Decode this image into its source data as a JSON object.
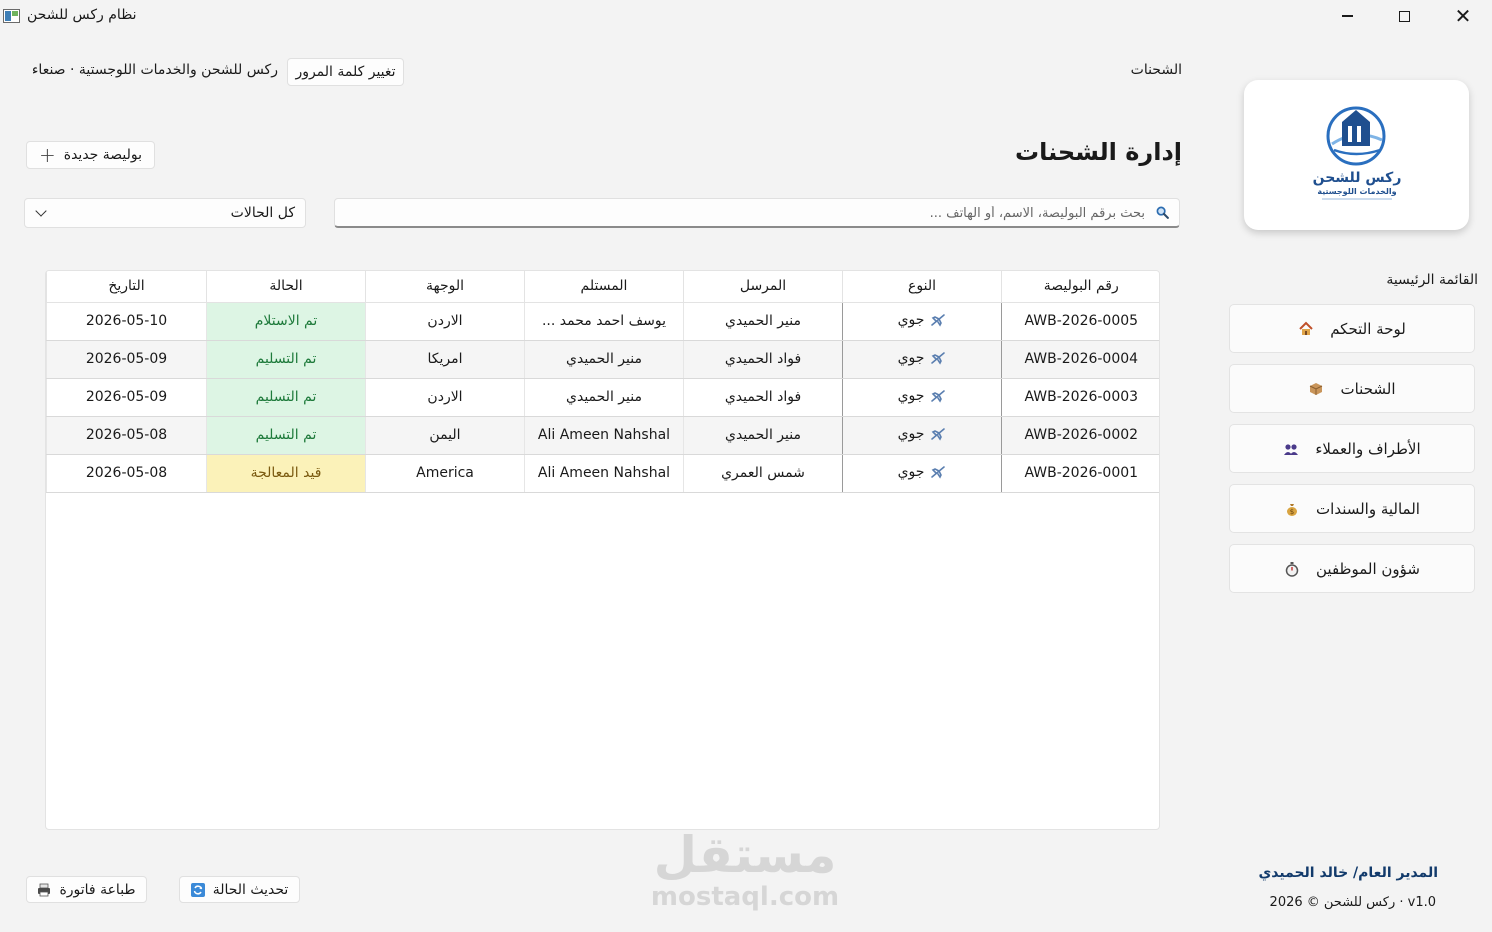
{
  "window": {
    "title": "نظام ركس للشحن"
  },
  "header": {
    "breadcrumb": "الشحنات",
    "company": "ركس للشحن والخدمات اللوجستية · صنعاء",
    "change_password": "تغيير كلمة المرور"
  },
  "page": {
    "title": "إدارة الشحنات",
    "new_button": "بوليصة جديدة",
    "status_filter": "كل الحالات",
    "search_placeholder": "بحث برقم البوليصة، الاسم، أو الهاتف ..."
  },
  "table": {
    "columns": [
      "رقم البوليصة",
      "النوع",
      "المرسل",
      "المستلم",
      "الوجهة",
      "الحالة",
      "التاريخ"
    ],
    "rows": [
      {
        "awb": "AWB-2026-0005",
        "type": "جوي",
        "sender": "منير الحميدي",
        "receiver": "يوسف احمد محمد ...",
        "destination": "الاردن",
        "status": "تم الاستلام",
        "date": "2026-05-10"
      },
      {
        "awb": "AWB-2026-0004",
        "type": "جوي",
        "sender": "فواد  الحميدي",
        "receiver": "منير الحميدي",
        "destination": "امريكا",
        "status": "تم التسليم",
        "date": "2026-05-09"
      },
      {
        "awb": "AWB-2026-0003",
        "type": "جوي",
        "sender": "فواد  الحميدي",
        "receiver": "منير الحميدي",
        "destination": "الاردن",
        "status": "تم التسليم",
        "date": "2026-05-09"
      },
      {
        "awb": "AWB-2026-0002",
        "type": "جوي",
        "sender": "منير الحميدي",
        "receiver": "Ali Ameen Nahshal",
        "destination": "اليمن",
        "status": "تم التسليم",
        "date": "2026-05-08"
      },
      {
        "awb": "AWB-2026-0001",
        "type": "جوي",
        "sender": "شمس العمري",
        "receiver": "Ali Ameen Nahshal",
        "destination": "America",
        "status": "قيد المعالجة",
        "date": "2026-05-08"
      }
    ]
  },
  "sidebar": {
    "heading": "القائمة الرئيسية",
    "items": [
      {
        "label": "لوحة التحكم",
        "icon": "house-icon"
      },
      {
        "label": "الشحنات",
        "icon": "package-icon"
      },
      {
        "label": "الأطراف والعملاء",
        "icon": "users-icon"
      },
      {
        "label": "المالية والسندات",
        "icon": "money-bag-icon"
      },
      {
        "label": "شؤون الموظفين",
        "icon": "stopwatch-icon"
      }
    ],
    "logo": {
      "name": "ركس للشحن",
      "sub": "والخدمات اللوجستية"
    }
  },
  "footer": {
    "manager": "المدير العام/ خالد الحميدي",
    "copyright": "ركس للشحن © 2026 · v1.0",
    "refresh_button": "تحديث الحالة",
    "print_button": "طباعة فاتورة"
  },
  "watermark": {
    "ar": "مستقل",
    "en": "mostaql.com"
  },
  "colors": {
    "status_done_bg": "#ddf5e4",
    "status_pending_bg": "#fbf2b9",
    "logo_blue": "#1f5aa8"
  }
}
